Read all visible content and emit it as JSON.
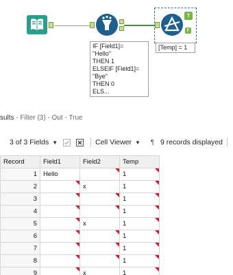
{
  "workflow": {
    "filter_annotation_lines": [
      "IF [Field1]=",
      "\"Hello\"",
      "THEN 1",
      "ELSEIF [Field1]=",
      "\"Bye\"",
      "THEN 0",
      "ELS..."
    ],
    "formula_annotation": "[Temp] = 1",
    "true_anchor": "T",
    "false_anchor": "F",
    "colors": {
      "input_tool": "#2a9d8f",
      "filter_tool": "#1e5f8c",
      "formula_tool": "#1e5f8c",
      "anchor_green": "#8bc34a",
      "connection_green": "#3f8f3c"
    }
  },
  "results": {
    "title_prefix": "sults",
    "title_detail": " - Filter (3) - Out - True",
    "toolbar": {
      "fields_label": "3 of 3 Fields",
      "cell_viewer_label": "Cell Viewer",
      "records_label": "9 records displayed"
    },
    "columns": [
      "Record",
      "Field1",
      "Field2",
      "Temp"
    ],
    "rows": [
      {
        "record": "1",
        "field1": "Hello",
        "field2": "",
        "temp": "1",
        "flags": [
          false,
          true,
          true
        ]
      },
      {
        "record": "2",
        "field1": "",
        "field2": "x",
        "temp": "1",
        "flags": [
          true,
          false,
          true
        ]
      },
      {
        "record": "3",
        "field1": "",
        "field2": "",
        "temp": "1",
        "flags": [
          true,
          true,
          true
        ]
      },
      {
        "record": "4",
        "field1": "",
        "field2": "",
        "temp": "1",
        "flags": [
          true,
          true,
          true
        ]
      },
      {
        "record": "5",
        "field1": "",
        "field2": "x",
        "temp": "1",
        "flags": [
          true,
          false,
          true
        ]
      },
      {
        "record": "6",
        "field1": "",
        "field2": "",
        "temp": "1",
        "flags": [
          true,
          true,
          true
        ]
      },
      {
        "record": "7",
        "field1": "",
        "field2": "",
        "temp": "1",
        "flags": [
          true,
          true,
          true
        ]
      },
      {
        "record": "8",
        "field1": "",
        "field2": "",
        "temp": "1",
        "flags": [
          true,
          true,
          true
        ]
      },
      {
        "record": "9",
        "field1": "",
        "field2": "x",
        "temp": "1",
        "flags": [
          true,
          false,
          true
        ]
      }
    ]
  }
}
